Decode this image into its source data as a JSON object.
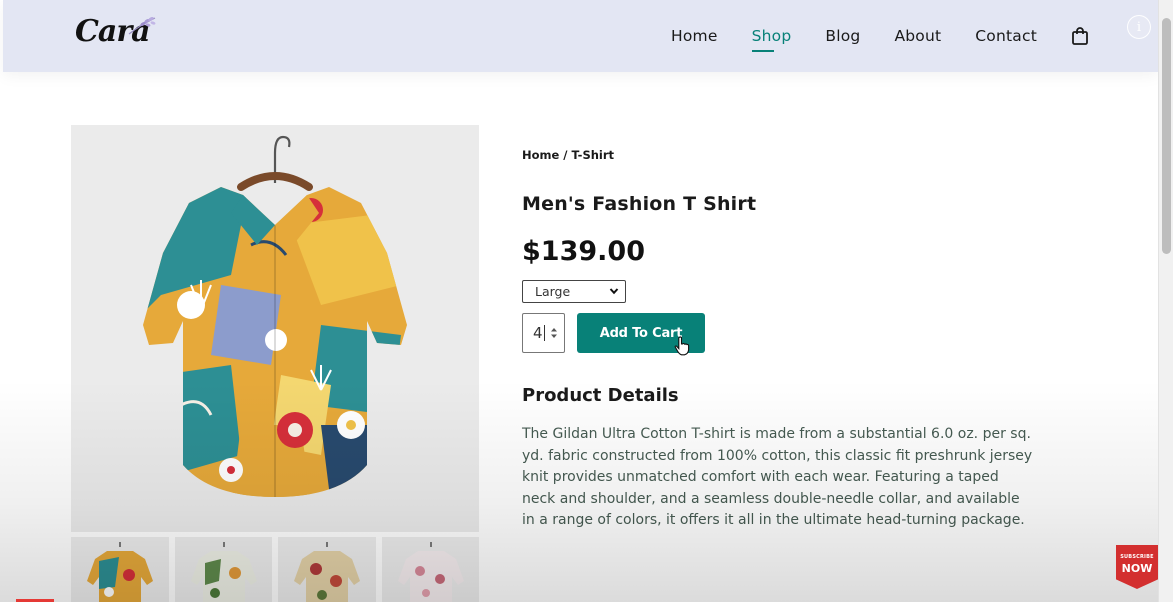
{
  "brand": {
    "logo_text": "Cara"
  },
  "nav": {
    "items": [
      {
        "label": "Home",
        "active": false
      },
      {
        "label": "Shop",
        "active": true
      },
      {
        "label": "Blog",
        "active": false
      },
      {
        "label": "About",
        "active": false
      },
      {
        "label": "Contact",
        "active": false
      }
    ],
    "cart_icon": "shopping-bag-icon",
    "accent_color": "#088178"
  },
  "product": {
    "breadcrumb": "Home / T-Shirt",
    "title": "Men's Fashion T Shirt",
    "price": "$139.00",
    "size_select": {
      "selected": "Large"
    },
    "quantity": "4",
    "add_to_cart_label": "Add To Cart",
    "details_heading": "Product Details",
    "description": "The Gildan Ultra Cotton T-shirt is made from a substantial 6.0 oz. per sq. yd. fabric constructed from 100% cotton, this classic fit preshrunk jersey knit provides unmatched comfort with each wear. Featuring a taped neck and shoulder, and a seamless double-needle collar, and available in a range of colors, it offers it all in the ultimate head-turning package."
  },
  "overlay": {
    "subscribe_small": "SUBSCRIBE",
    "subscribe_big": "NOW"
  },
  "colors": {
    "header_bg": "#e3e6f3",
    "button_bg": "#088178",
    "description_text": "#465b52"
  }
}
